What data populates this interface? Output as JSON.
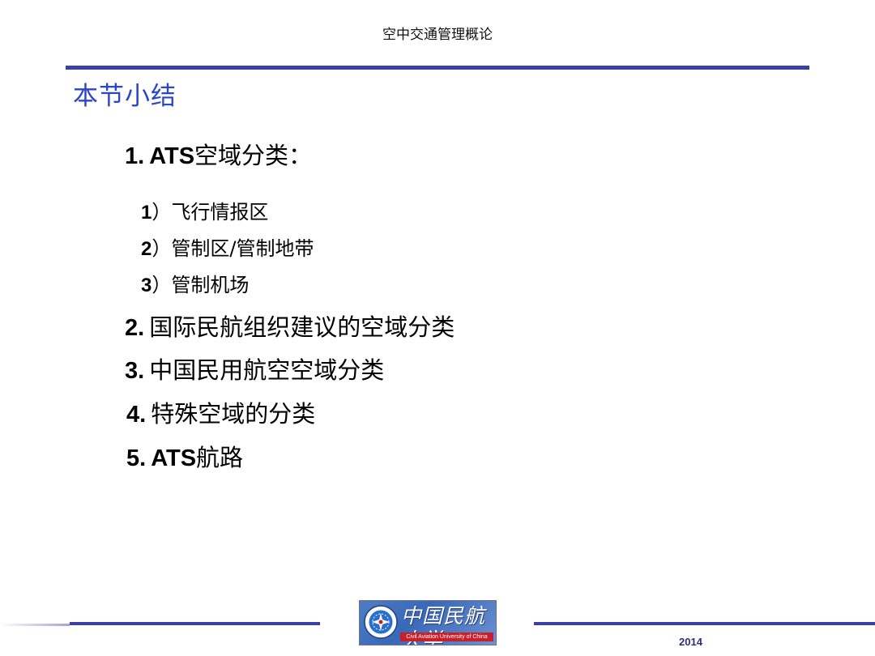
{
  "header": {
    "course_title": "空中交通管理概论"
  },
  "slide": {
    "heading": "本节小结",
    "items": [
      {
        "num": "1.",
        "latin": "ATS",
        "text": "空域分类："
      },
      {
        "num": "2.",
        "text": "国际民航组织建议的空域分类"
      },
      {
        "num": "3.",
        "text": "中国民用航空空域分类"
      },
      {
        "num": "4.",
        "text": "特殊空域的分类"
      },
      {
        "num": "5.",
        "latin": "ATS",
        "text": "航路"
      }
    ],
    "subitems": [
      {
        "num": "1",
        "text": "）飞行情报区"
      },
      {
        "num": "2",
        "text": "）管制区/管制地带"
      },
      {
        "num": "3",
        "text": "）管制机场"
      }
    ]
  },
  "footer": {
    "logo_name": "中国民航大学",
    "logo_subtitle": "Civil Aviation University of China",
    "year": "2014"
  },
  "colors": {
    "rule": "#3b40a4",
    "heading": "#2c46c8",
    "logo_background": "#4f7ec2",
    "logo_subtitle_bar": "#c8202a"
  }
}
